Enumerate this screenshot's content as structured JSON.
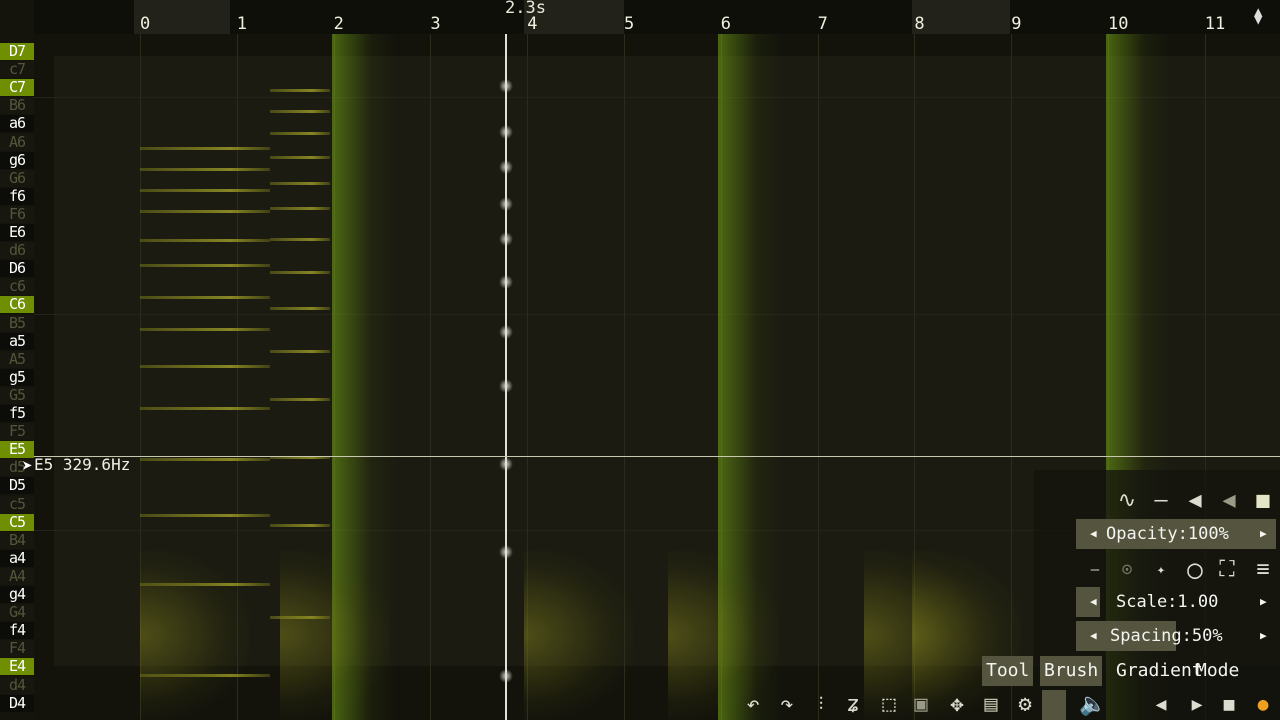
{
  "ruler": {
    "ticks": [
      "0",
      "1",
      "2",
      "3",
      "4",
      "5",
      "6",
      "7",
      "8",
      "9",
      "10",
      "11"
    ],
    "playhead": "2.3s"
  },
  "keys": [
    {
      "label": "D7",
      "t": "c"
    },
    {
      "label": "c7",
      "t": "b"
    },
    {
      "label": "C7",
      "t": "c"
    },
    {
      "label": "B6",
      "t": "b"
    },
    {
      "label": "a6",
      "t": "w"
    },
    {
      "label": "A6",
      "t": "b"
    },
    {
      "label": "g6",
      "t": "w"
    },
    {
      "label": "G6",
      "t": "b"
    },
    {
      "label": "f6",
      "t": "w"
    },
    {
      "label": "F6",
      "t": "b"
    },
    {
      "label": "E6",
      "t": "w"
    },
    {
      "label": "d6",
      "t": "b"
    },
    {
      "label": "D6",
      "t": "w"
    },
    {
      "label": "c6",
      "t": "b"
    },
    {
      "label": "C6",
      "t": "c"
    },
    {
      "label": "B5",
      "t": "b"
    },
    {
      "label": "a5",
      "t": "w"
    },
    {
      "label": "A5",
      "t": "b"
    },
    {
      "label": "g5",
      "t": "w"
    },
    {
      "label": "G5",
      "t": "b"
    },
    {
      "label": "f5",
      "t": "w"
    },
    {
      "label": "F5",
      "t": "b"
    },
    {
      "label": "E5",
      "t": "c"
    },
    {
      "label": "d5",
      "t": "b"
    },
    {
      "label": "D5",
      "t": "w"
    },
    {
      "label": "c5",
      "t": "b"
    },
    {
      "label": "C5",
      "t": "c"
    },
    {
      "label": "B4",
      "t": "b"
    },
    {
      "label": "a4",
      "t": "w"
    },
    {
      "label": "A4",
      "t": "b"
    },
    {
      "label": "g4",
      "t": "w"
    },
    {
      "label": "G4",
      "t": "b"
    },
    {
      "label": "f4",
      "t": "w"
    },
    {
      "label": "F4",
      "t": "b"
    },
    {
      "label": "E4",
      "t": "c"
    },
    {
      "label": "d4",
      "t": "b"
    },
    {
      "label": "D4",
      "t": "w"
    }
  ],
  "cursor_readout": "E5 329.6Hz",
  "panel": {
    "opacity_label": "Opacity:100%",
    "scale_label": "Scale:1.00",
    "spacing_label": "Spacing:50%",
    "tabs": [
      "Tool",
      "Brush",
      "Gradient",
      "Mode"
    ]
  },
  "icons": [
    "undo-icon",
    "redo-icon",
    "mixer-icon",
    "curve-tool-icon",
    "select-rect-icon",
    "select-fill-icon",
    "move-icon",
    "save-icon",
    "settings-icon",
    "volume-icon",
    "prev-icon",
    "play-icon",
    "stop-icon",
    "record-icon"
  ]
}
